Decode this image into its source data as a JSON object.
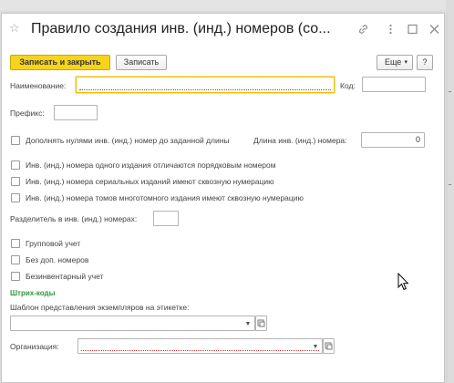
{
  "window": {
    "title": "Правило создания инв. (инд.) номеров (со..."
  },
  "toolbar": {
    "save_close_label": "Записать и закрыть",
    "save_label": "Записать",
    "more_label": "Еще"
  },
  "form": {
    "name_label": "Наименование:",
    "name_value": "",
    "code_label": "Код:",
    "code_value": "",
    "prefix_label": "Префикс:",
    "prefix_value": "",
    "pad_zeros_label": "Дополнять нулями инв. (инд.) номер до заданной длины",
    "pad_zeros_checked": false,
    "length_label": "Длина инв. (инд.) номера:",
    "length_value": "0",
    "option1_label": "Инв. (инд.) номера одного издания отличаются порядковым номером",
    "option1_checked": false,
    "option2_label": "Инв. (инд.) номера сериальных изданий имеют сквозную нумерацию",
    "option2_checked": false,
    "option3_label": "Инв. (инд.) номера томов многотомного издания имеют сквозную нумерацию",
    "option3_checked": false,
    "separator_label": "Разделитель в инв. (инд.) номерах:",
    "separator_value": "",
    "group_label": "Групповой учет",
    "group_checked": false,
    "no_extra_label": "Без доп. номеров",
    "no_extra_checked": false,
    "no_inventory_label": "Безинвентарный учет",
    "no_inventory_checked": false,
    "barcodes_section": "Штрих-коды",
    "template_label": "Шаблон представления экземпляров на этикетке:",
    "template_value": "",
    "org_label": "Организация:",
    "org_value": ""
  },
  "colors": {
    "primary_button": "#f7d41a",
    "section_heading": "#2a9a3c",
    "focus_border": "#f0c000"
  },
  "icons": {
    "favorite": "star-icon",
    "link": "link-icon",
    "menu": "more-vert-icon",
    "maximize": "maximize-icon",
    "close": "close-icon",
    "cursor": "mouse-cursor-icon"
  }
}
